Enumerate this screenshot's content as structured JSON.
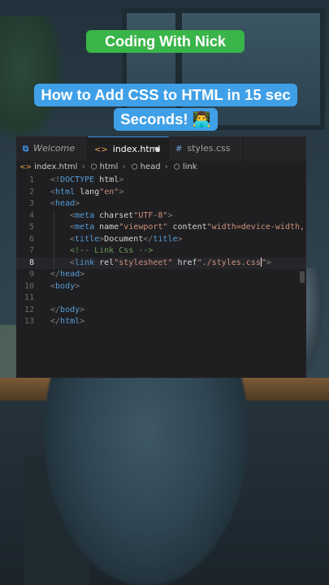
{
  "captions": {
    "title": "Coding With Nick",
    "subtitle_line1": "How to Add CSS to HTML in 15 sec",
    "subtitle_line2": "Seconds! 👨‍💻",
    "title_color": "#3ab54a",
    "subtitle_color": "#3fa0e8"
  },
  "editor": {
    "tabs": [
      {
        "label": "Welcome",
        "icon": "vscode-logo-icon",
        "active": false
      },
      {
        "label": "index.html",
        "icon": "html-file-icon",
        "active": true,
        "modified": true
      },
      {
        "label": "styles.css",
        "icon": "css-hash-icon",
        "active": false
      }
    ],
    "breadcrumb": [
      "index.html",
      "html",
      "head",
      "link"
    ],
    "active_line": 8,
    "lines": [
      {
        "n": "1",
        "text": "<!DOCTYPE html>"
      },
      {
        "n": "2",
        "text": "<html lang=\"en\">"
      },
      {
        "n": "3",
        "text": "<head>"
      },
      {
        "n": "4",
        "text": "<meta charset=\"UTF-8\">"
      },
      {
        "n": "5",
        "text": "<meta name=\"viewport\" content=\"width=device-width,"
      },
      {
        "n": "6",
        "text": "<title>Document</title>"
      },
      {
        "n": "7",
        "text": "<!-- Link Css -->"
      },
      {
        "n": "8",
        "text": "<link rel=\"stylesheet\" href=\"./styles.css\">"
      },
      {
        "n": "9",
        "text": "</head>"
      },
      {
        "n": "10",
        "text": "<body>"
      },
      {
        "n": "11",
        "text": ""
      },
      {
        "n": "12",
        "text": "</body>"
      },
      {
        "n": "13",
        "text": "</html>"
      }
    ]
  }
}
